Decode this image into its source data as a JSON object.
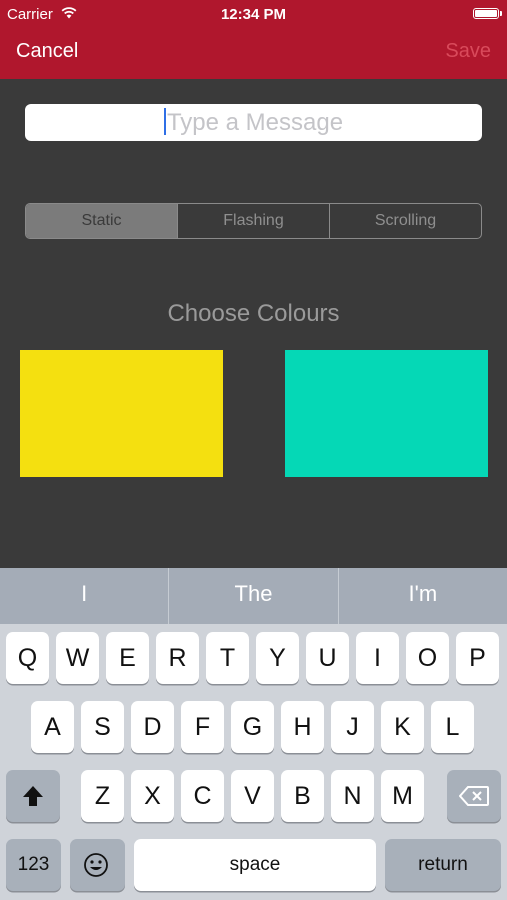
{
  "status_bar": {
    "carrier": "Carrier",
    "time": "12:34 PM",
    "wifi_icon": "wifi-icon",
    "battery_icon": "battery-icon"
  },
  "nav": {
    "cancel": "Cancel",
    "save": "Save"
  },
  "message_input": {
    "placeholder": "Type a Message",
    "value": ""
  },
  "mode_segments": [
    "Static",
    "Flashing",
    "Scrolling"
  ],
  "selected_mode": "Static",
  "colours": {
    "title": "Choose Colours",
    "swatches": [
      {
        "color": "#f4e010"
      },
      {
        "color": "#05d8b6"
      }
    ]
  },
  "predictions": [
    "I",
    "The",
    "I'm"
  ],
  "keyboard": {
    "row1": [
      "Q",
      "W",
      "E",
      "R",
      "T",
      "Y",
      "U",
      "I",
      "O",
      "P"
    ],
    "row2": [
      "A",
      "S",
      "D",
      "F",
      "G",
      "H",
      "J",
      "K",
      "L"
    ],
    "row3": [
      "Z",
      "X",
      "C",
      "V",
      "B",
      "N",
      "M"
    ],
    "shift_icon": "shift-icon",
    "backspace_icon": "backspace-icon",
    "emoji_icon": "emoji-icon",
    "numbers_label": "123",
    "space_label": "space",
    "return_label": "return"
  },
  "colors": {
    "navbar": "#b0172d",
    "background": "#3a3a3a",
    "keyboard": "#cfd3d9",
    "prediction_bar": "#a4acb7"
  }
}
